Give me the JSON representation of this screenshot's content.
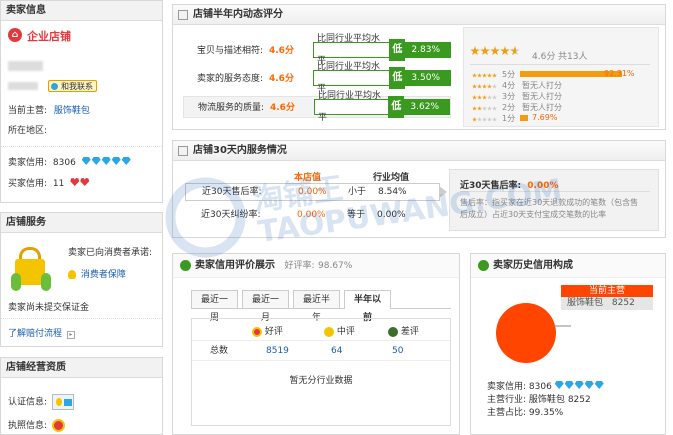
{
  "sidebar": {
    "seller_info": {
      "title": "卖家信息",
      "shop_type": "企业店铺",
      "contact_btn": "和我联系",
      "main_business_label": "当前主营:",
      "main_business": "服饰鞋包",
      "location_label": "所在地区:",
      "seller_credit_label": "卖家信用:",
      "seller_credit_value": "8306",
      "buyer_credit_label": "买家信用:",
      "buyer_credit_value": "11"
    },
    "shop_service": {
      "title": "店铺服务",
      "promise_text": "卖家已向消费者承诺:",
      "guarantee_link": "消费者保障",
      "deposit_text": "卖家尚未提交保证金",
      "compensation_link": "了解赔付流程"
    },
    "qualification": {
      "title": "店铺经营资质",
      "cert_label": "认证信息:",
      "license_label": "执照信息:"
    }
  },
  "dsr": {
    "title": "店铺半年内动态评分",
    "rows": [
      {
        "label": "宝贝与描述相符:",
        "score": "4.6分",
        "compare": "比同行业平均水平",
        "level": "低",
        "pct": "2.83%"
      },
      {
        "label": "卖家的服务态度:",
        "score": "4.6分",
        "compare": "比同行业平均水平",
        "level": "低",
        "pct": "3.50%"
      },
      {
        "label": "物流服务的质量:",
        "score": "4.6分",
        "compare": "比同行业平均水平",
        "level": "低",
        "pct": "3.62%"
      }
    ],
    "summary_score": "4.6分",
    "summary_count": "共13人",
    "distribution": [
      {
        "stars": 5,
        "label": "5分",
        "value": "92.31%",
        "fraction": 0.9231
      },
      {
        "stars": 4,
        "label": "4分",
        "value": "暂无人打分",
        "fraction": 0
      },
      {
        "stars": 3,
        "label": "3分",
        "value": "暂无人打分",
        "fraction": 0
      },
      {
        "stars": 2,
        "label": "2分",
        "value": "暂无人打分",
        "fraction": 0
      },
      {
        "stars": 1,
        "label": "1分",
        "value": "7.69%",
        "fraction": 0.0769
      }
    ]
  },
  "service30": {
    "title": "店铺30天内服务情况",
    "col_shop": "本店值",
    "col_industry": "行业均值",
    "rows": [
      {
        "label": "近30天售后率:",
        "shop": "0.00%",
        "cmp": "小于",
        "industry": "8.54%"
      },
      {
        "label": "近30天纠纷率:",
        "shop": "0.00%",
        "cmp": "等于",
        "industry": "0.00%"
      }
    ],
    "detail_title": "近30天售后率:",
    "detail_value": "0.00%",
    "detail_text": "售后率：指买家在近30天退款成功的笔数（包含售后成立）占近30天支付宝成交笔数的比率"
  },
  "credit_review": {
    "title": "卖家信用评价展示",
    "good_rate_label": "好评率:",
    "good_rate": "98.67%",
    "tabs": [
      "最近一周",
      "最近一月",
      "最近半年",
      "半年以前"
    ],
    "headers": {
      "good": "好评",
      "neutral": "中评",
      "bad": "差评"
    },
    "total_label": "总数",
    "totals": {
      "good": "8519",
      "neutral": "64",
      "bad": "50"
    },
    "no_data": "暂无分行业数据"
  },
  "history": {
    "title": "卖家历史信用构成",
    "legend_title": "当前主营",
    "legend_item": "服饰鞋包",
    "legend_value": "8252",
    "seller_credit_label": "卖家信用:",
    "seller_credit_value": "8306",
    "main_industry_label": "主营行业:",
    "main_industry": "服饰鞋包",
    "main_industry_value": "8252",
    "share_label": "主营占比:",
    "share_value": "99.35%",
    "pie_color": "#ff4500"
  },
  "watermark": "淘铺王 TAOPUWANG.COM"
}
